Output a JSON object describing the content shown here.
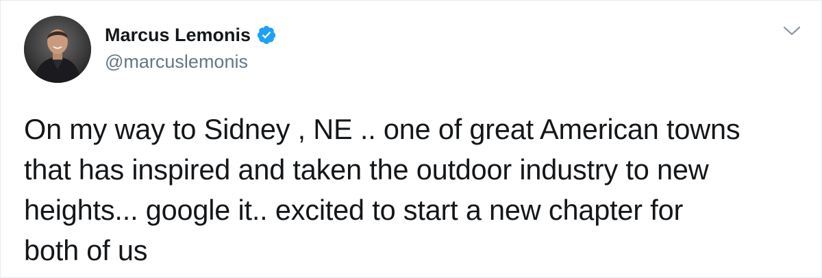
{
  "author": {
    "display_name": "Marcus Lemonis",
    "handle": "@marcuslemonis",
    "verified": true,
    "avatar_icon": "profile-photo",
    "verified_icon": "verified-badge-icon",
    "verified_color": "#1da1f2"
  },
  "menu": {
    "icon": "chevron-down-icon",
    "color": "#8899a6"
  },
  "tweet": {
    "text": "On my way to Sidney , NE .. one of great American towns\nthat has inspired and taken the outdoor industry to new\nheights... google it.. excited to start a new chapter for\nboth of us"
  }
}
